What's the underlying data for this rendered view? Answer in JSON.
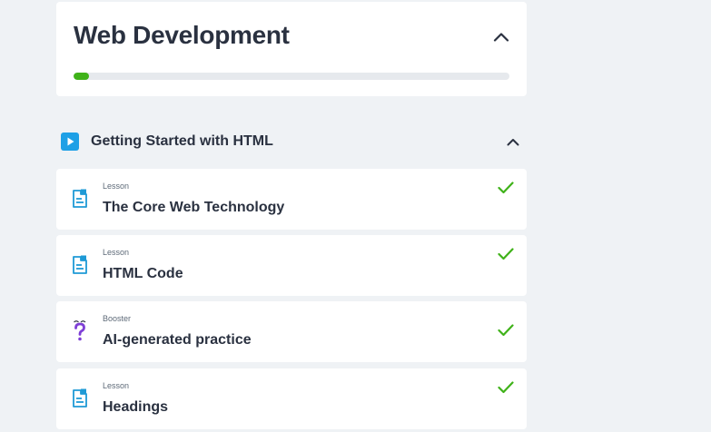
{
  "course": {
    "title": "Web Development",
    "progress": 0.035,
    "progress_color": "#3fb219",
    "collapse_icon": "chevron-up-icon"
  },
  "section": {
    "title": "Getting Started with HTML",
    "icon": "play-square-icon",
    "icon_color": "#1ea0e6",
    "expanded": true
  },
  "items": [
    {
      "type": "Lesson",
      "title": "The Core Web Technology",
      "icon": "document-icon",
      "completed": true
    },
    {
      "type": "Lesson",
      "title": "HTML Code",
      "icon": "document-icon",
      "completed": true
    },
    {
      "type": "Booster",
      "title": "AI-generated practice",
      "icon": "question-mark-icon",
      "completed": true
    },
    {
      "type": "Lesson",
      "title": "Headings",
      "icon": "document-icon",
      "completed": true
    }
  ],
  "colors": {
    "lesson_icon": "#1e9ad6",
    "booster_icon": "#7e3fd6",
    "check": "#3fb219",
    "background": "#eff2f5"
  }
}
